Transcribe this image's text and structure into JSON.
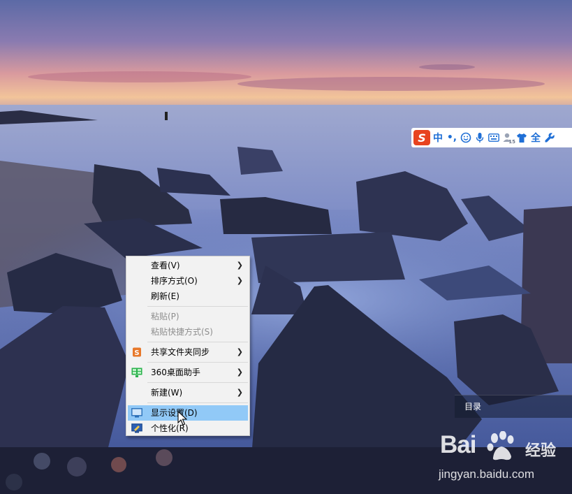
{
  "context_menu": {
    "items": [
      {
        "label": "查看(V)",
        "submenu": true
      },
      {
        "label": "排序方式(O)",
        "submenu": true
      },
      {
        "label": "刷新(E)"
      },
      {
        "label": "粘贴(P)",
        "disabled": true
      },
      {
        "label": "粘贴快捷方式(S)",
        "disabled": true
      },
      {
        "label": "共享文件夹同步",
        "submenu": true,
        "icon": "share-sync-icon"
      },
      {
        "label": "360桌面助手",
        "submenu": true,
        "icon": "360-desktop-icon"
      },
      {
        "label": "新建(W)",
        "submenu": true
      },
      {
        "label": "显示设置(D)",
        "icon": "display-settings-icon",
        "highlighted": true
      },
      {
        "label": "个性化(R)",
        "icon": "personalize-icon"
      }
    ]
  },
  "ime_toolbar": {
    "logo": "S",
    "mode": "中",
    "punct": "•,",
    "items": [
      "emoji-icon",
      "microphone-icon",
      "keyboard-icon",
      "user-15-icon",
      "tshirt-skin-icon",
      "fullwidth-icon",
      "wrench-icon"
    ],
    "fullwidth_label": "全",
    "badge": "15"
  },
  "sidebar": {
    "toc_label": "目录"
  },
  "watermark": {
    "brand": "Bai",
    "brand2": "经验",
    "url": "jingyan.baidu.com"
  },
  "colors": {
    "highlight": "#91c9f7",
    "menu_bg": "#f2f2f2",
    "ime_blue": "#1f6fd6",
    "ime_logo": "#e8431f"
  }
}
